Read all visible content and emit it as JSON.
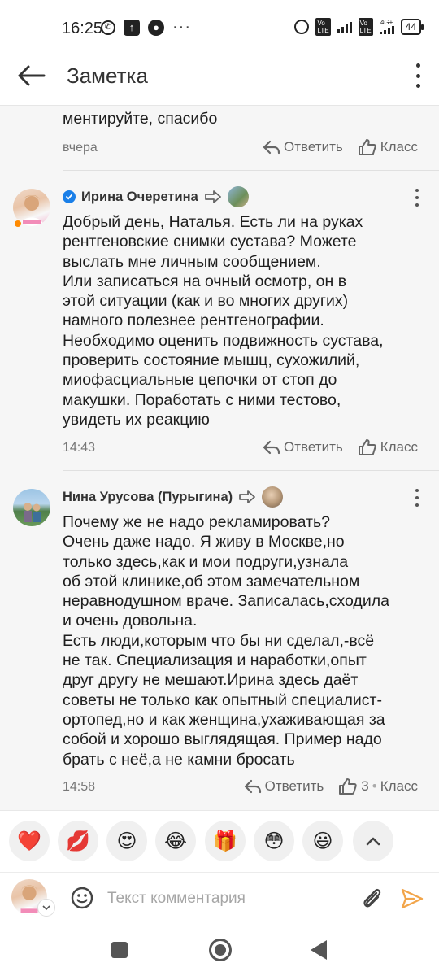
{
  "status_bar": {
    "time": "16:25",
    "battery": "44",
    "network_label": "4G+",
    "volte_label": "Vo LTE"
  },
  "app_bar": {
    "title": "Заметка"
  },
  "comments": [
    {
      "text": "ментируйте, спасибо",
      "time": "вчера",
      "reply_label": "Ответить",
      "like_label": "Класс"
    },
    {
      "author": "Ирина Очеретина",
      "text_lines": [
        "Добрый день, Наталья. Есть ли на руках",
        "рентгеновские снимки сустава? Можете",
        "выслать мне личным сообщением.",
        "Или записаться на очный осмотр, он в",
        "этой ситуации (как и во многих других)",
        "намного полезнее рентгенографии.",
        "Необходимо оценить подвижность сустава,",
        "проверить состояние мышц, сухожилий,",
        "миофасциальные цепочки от стоп до",
        "макушки. Поработать с ними тестово,",
        "увидеть их реакцию"
      ],
      "time": "14:43",
      "reply_label": "Ответить",
      "like_label": "Класс"
    },
    {
      "author": "Нина Урусова (Пурыгина)",
      "text_lines": [
        "Почему же не надо рекламировать?",
        "Очень даже надо. Я живу в Москве,но",
        "только здесь,как и мои подруги,узнала",
        "об этой клинике,об этом замечательном",
        "неравнодушном враче. Записалась,сходила",
        "и очень довольна.",
        "Есть люди,которым что бы ни сделал,-всё",
        "не так. Специализация и наработки,опыт",
        "друг другу не мешают.Ирина здесь даёт",
        "советы не только как опытный специалист-",
        "ортопед,но и как женщина,ухаживающая за",
        "собой и хорошо выглядящая. Пример надо",
        "брать с неё,а не камни бросать"
      ],
      "time": "14:58",
      "reply_label": "Ответить",
      "like_count": "3",
      "like_label": "Класс"
    }
  ],
  "reactions": [
    {
      "name": "heart",
      "glyph": "❤️"
    },
    {
      "name": "kiss",
      "glyph": "💋"
    },
    {
      "name": "heart-eyes",
      "glyph": "😍"
    },
    {
      "name": "laughing",
      "glyph": "😂"
    },
    {
      "name": "gift",
      "glyph": "🎁"
    },
    {
      "name": "flushed",
      "glyph": "😳"
    },
    {
      "name": "smiley",
      "glyph": "😃"
    }
  ],
  "composer": {
    "placeholder": "Текст комментария"
  },
  "icons": {
    "back": "arrow-left-icon",
    "more": "more-vertical-icon",
    "reply": "reply-arrow-icon",
    "like": "thumbs-up-icon",
    "smile": "smile-icon",
    "attach": "paperclip-icon",
    "send": "send-icon"
  },
  "colors": {
    "accent": "#ee8208",
    "verified": "#1a7fe8",
    "online": "#ff8a00",
    "background": "#f6f6f6"
  }
}
